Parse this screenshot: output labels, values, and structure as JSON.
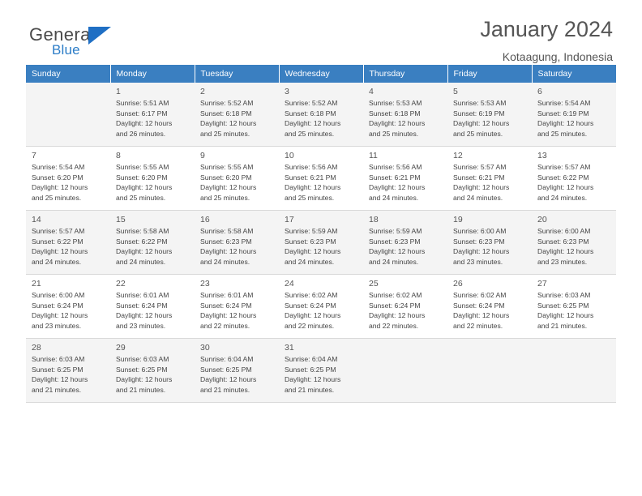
{
  "logo": {
    "general": "General",
    "blue": "Blue",
    "triangle": "blue-triangle-icon"
  },
  "header": {
    "title": "January 2024",
    "location": "Kotaagung, Indonesia"
  },
  "calendar": {
    "weekday_headers": [
      "Sunday",
      "Monday",
      "Tuesday",
      "Wednesday",
      "Thursday",
      "Friday",
      "Saturday"
    ],
    "weeks": [
      [
        {
          "day": ""
        },
        {
          "day": "1",
          "sunrise": "Sunrise: 5:51 AM",
          "sunset": "Sunset: 6:17 PM",
          "daylight1": "Daylight: 12 hours",
          "daylight2": "and 26 minutes."
        },
        {
          "day": "2",
          "sunrise": "Sunrise: 5:52 AM",
          "sunset": "Sunset: 6:18 PM",
          "daylight1": "Daylight: 12 hours",
          "daylight2": "and 25 minutes."
        },
        {
          "day": "3",
          "sunrise": "Sunrise: 5:52 AM",
          "sunset": "Sunset: 6:18 PM",
          "daylight1": "Daylight: 12 hours",
          "daylight2": "and 25 minutes."
        },
        {
          "day": "4",
          "sunrise": "Sunrise: 5:53 AM",
          "sunset": "Sunset: 6:18 PM",
          "daylight1": "Daylight: 12 hours",
          "daylight2": "and 25 minutes."
        },
        {
          "day": "5",
          "sunrise": "Sunrise: 5:53 AM",
          "sunset": "Sunset: 6:19 PM",
          "daylight1": "Daylight: 12 hours",
          "daylight2": "and 25 minutes."
        },
        {
          "day": "6",
          "sunrise": "Sunrise: 5:54 AM",
          "sunset": "Sunset: 6:19 PM",
          "daylight1": "Daylight: 12 hours",
          "daylight2": "and 25 minutes."
        }
      ],
      [
        {
          "day": "7",
          "sunrise": "Sunrise: 5:54 AM",
          "sunset": "Sunset: 6:20 PM",
          "daylight1": "Daylight: 12 hours",
          "daylight2": "and 25 minutes."
        },
        {
          "day": "8",
          "sunrise": "Sunrise: 5:55 AM",
          "sunset": "Sunset: 6:20 PM",
          "daylight1": "Daylight: 12 hours",
          "daylight2": "and 25 minutes."
        },
        {
          "day": "9",
          "sunrise": "Sunrise: 5:55 AM",
          "sunset": "Sunset: 6:20 PM",
          "daylight1": "Daylight: 12 hours",
          "daylight2": "and 25 minutes."
        },
        {
          "day": "10",
          "sunrise": "Sunrise: 5:56 AM",
          "sunset": "Sunset: 6:21 PM",
          "daylight1": "Daylight: 12 hours",
          "daylight2": "and 25 minutes."
        },
        {
          "day": "11",
          "sunrise": "Sunrise: 5:56 AM",
          "sunset": "Sunset: 6:21 PM",
          "daylight1": "Daylight: 12 hours",
          "daylight2": "and 24 minutes."
        },
        {
          "day": "12",
          "sunrise": "Sunrise: 5:57 AM",
          "sunset": "Sunset: 6:21 PM",
          "daylight1": "Daylight: 12 hours",
          "daylight2": "and 24 minutes."
        },
        {
          "day": "13",
          "sunrise": "Sunrise: 5:57 AM",
          "sunset": "Sunset: 6:22 PM",
          "daylight1": "Daylight: 12 hours",
          "daylight2": "and 24 minutes."
        }
      ],
      [
        {
          "day": "14",
          "sunrise": "Sunrise: 5:57 AM",
          "sunset": "Sunset: 6:22 PM",
          "daylight1": "Daylight: 12 hours",
          "daylight2": "and 24 minutes."
        },
        {
          "day": "15",
          "sunrise": "Sunrise: 5:58 AM",
          "sunset": "Sunset: 6:22 PM",
          "daylight1": "Daylight: 12 hours",
          "daylight2": "and 24 minutes."
        },
        {
          "day": "16",
          "sunrise": "Sunrise: 5:58 AM",
          "sunset": "Sunset: 6:23 PM",
          "daylight1": "Daylight: 12 hours",
          "daylight2": "and 24 minutes."
        },
        {
          "day": "17",
          "sunrise": "Sunrise: 5:59 AM",
          "sunset": "Sunset: 6:23 PM",
          "daylight1": "Daylight: 12 hours",
          "daylight2": "and 24 minutes."
        },
        {
          "day": "18",
          "sunrise": "Sunrise: 5:59 AM",
          "sunset": "Sunset: 6:23 PM",
          "daylight1": "Daylight: 12 hours",
          "daylight2": "and 24 minutes."
        },
        {
          "day": "19",
          "sunrise": "Sunrise: 6:00 AM",
          "sunset": "Sunset: 6:23 PM",
          "daylight1": "Daylight: 12 hours",
          "daylight2": "and 23 minutes."
        },
        {
          "day": "20",
          "sunrise": "Sunrise: 6:00 AM",
          "sunset": "Sunset: 6:23 PM",
          "daylight1": "Daylight: 12 hours",
          "daylight2": "and 23 minutes."
        }
      ],
      [
        {
          "day": "21",
          "sunrise": "Sunrise: 6:00 AM",
          "sunset": "Sunset: 6:24 PM",
          "daylight1": "Daylight: 12 hours",
          "daylight2": "and 23 minutes."
        },
        {
          "day": "22",
          "sunrise": "Sunrise: 6:01 AM",
          "sunset": "Sunset: 6:24 PM",
          "daylight1": "Daylight: 12 hours",
          "daylight2": "and 23 minutes."
        },
        {
          "day": "23",
          "sunrise": "Sunrise: 6:01 AM",
          "sunset": "Sunset: 6:24 PM",
          "daylight1": "Daylight: 12 hours",
          "daylight2": "and 22 minutes."
        },
        {
          "day": "24",
          "sunrise": "Sunrise: 6:02 AM",
          "sunset": "Sunset: 6:24 PM",
          "daylight1": "Daylight: 12 hours",
          "daylight2": "and 22 minutes."
        },
        {
          "day": "25",
          "sunrise": "Sunrise: 6:02 AM",
          "sunset": "Sunset: 6:24 PM",
          "daylight1": "Daylight: 12 hours",
          "daylight2": "and 22 minutes."
        },
        {
          "day": "26",
          "sunrise": "Sunrise: 6:02 AM",
          "sunset": "Sunset: 6:24 PM",
          "daylight1": "Daylight: 12 hours",
          "daylight2": "and 22 minutes."
        },
        {
          "day": "27",
          "sunrise": "Sunrise: 6:03 AM",
          "sunset": "Sunset: 6:25 PM",
          "daylight1": "Daylight: 12 hours",
          "daylight2": "and 21 minutes."
        }
      ],
      [
        {
          "day": "28",
          "sunrise": "Sunrise: 6:03 AM",
          "sunset": "Sunset: 6:25 PM",
          "daylight1": "Daylight: 12 hours",
          "daylight2": "and 21 minutes."
        },
        {
          "day": "29",
          "sunrise": "Sunrise: 6:03 AM",
          "sunset": "Sunset: 6:25 PM",
          "daylight1": "Daylight: 12 hours",
          "daylight2": "and 21 minutes."
        },
        {
          "day": "30",
          "sunrise": "Sunrise: 6:04 AM",
          "sunset": "Sunset: 6:25 PM",
          "daylight1": "Daylight: 12 hours",
          "daylight2": "and 21 minutes."
        },
        {
          "day": "31",
          "sunrise": "Sunrise: 6:04 AM",
          "sunset": "Sunset: 6:25 PM",
          "daylight1": "Daylight: 12 hours",
          "daylight2": "and 21 minutes."
        },
        {
          "day": ""
        },
        {
          "day": ""
        },
        {
          "day": ""
        }
      ]
    ]
  },
  "colors": {
    "header_blue": "#3a7fc1",
    "logo_blue": "#2b7cc7",
    "row_alt": "#f4f4f4",
    "text": "#444444"
  }
}
